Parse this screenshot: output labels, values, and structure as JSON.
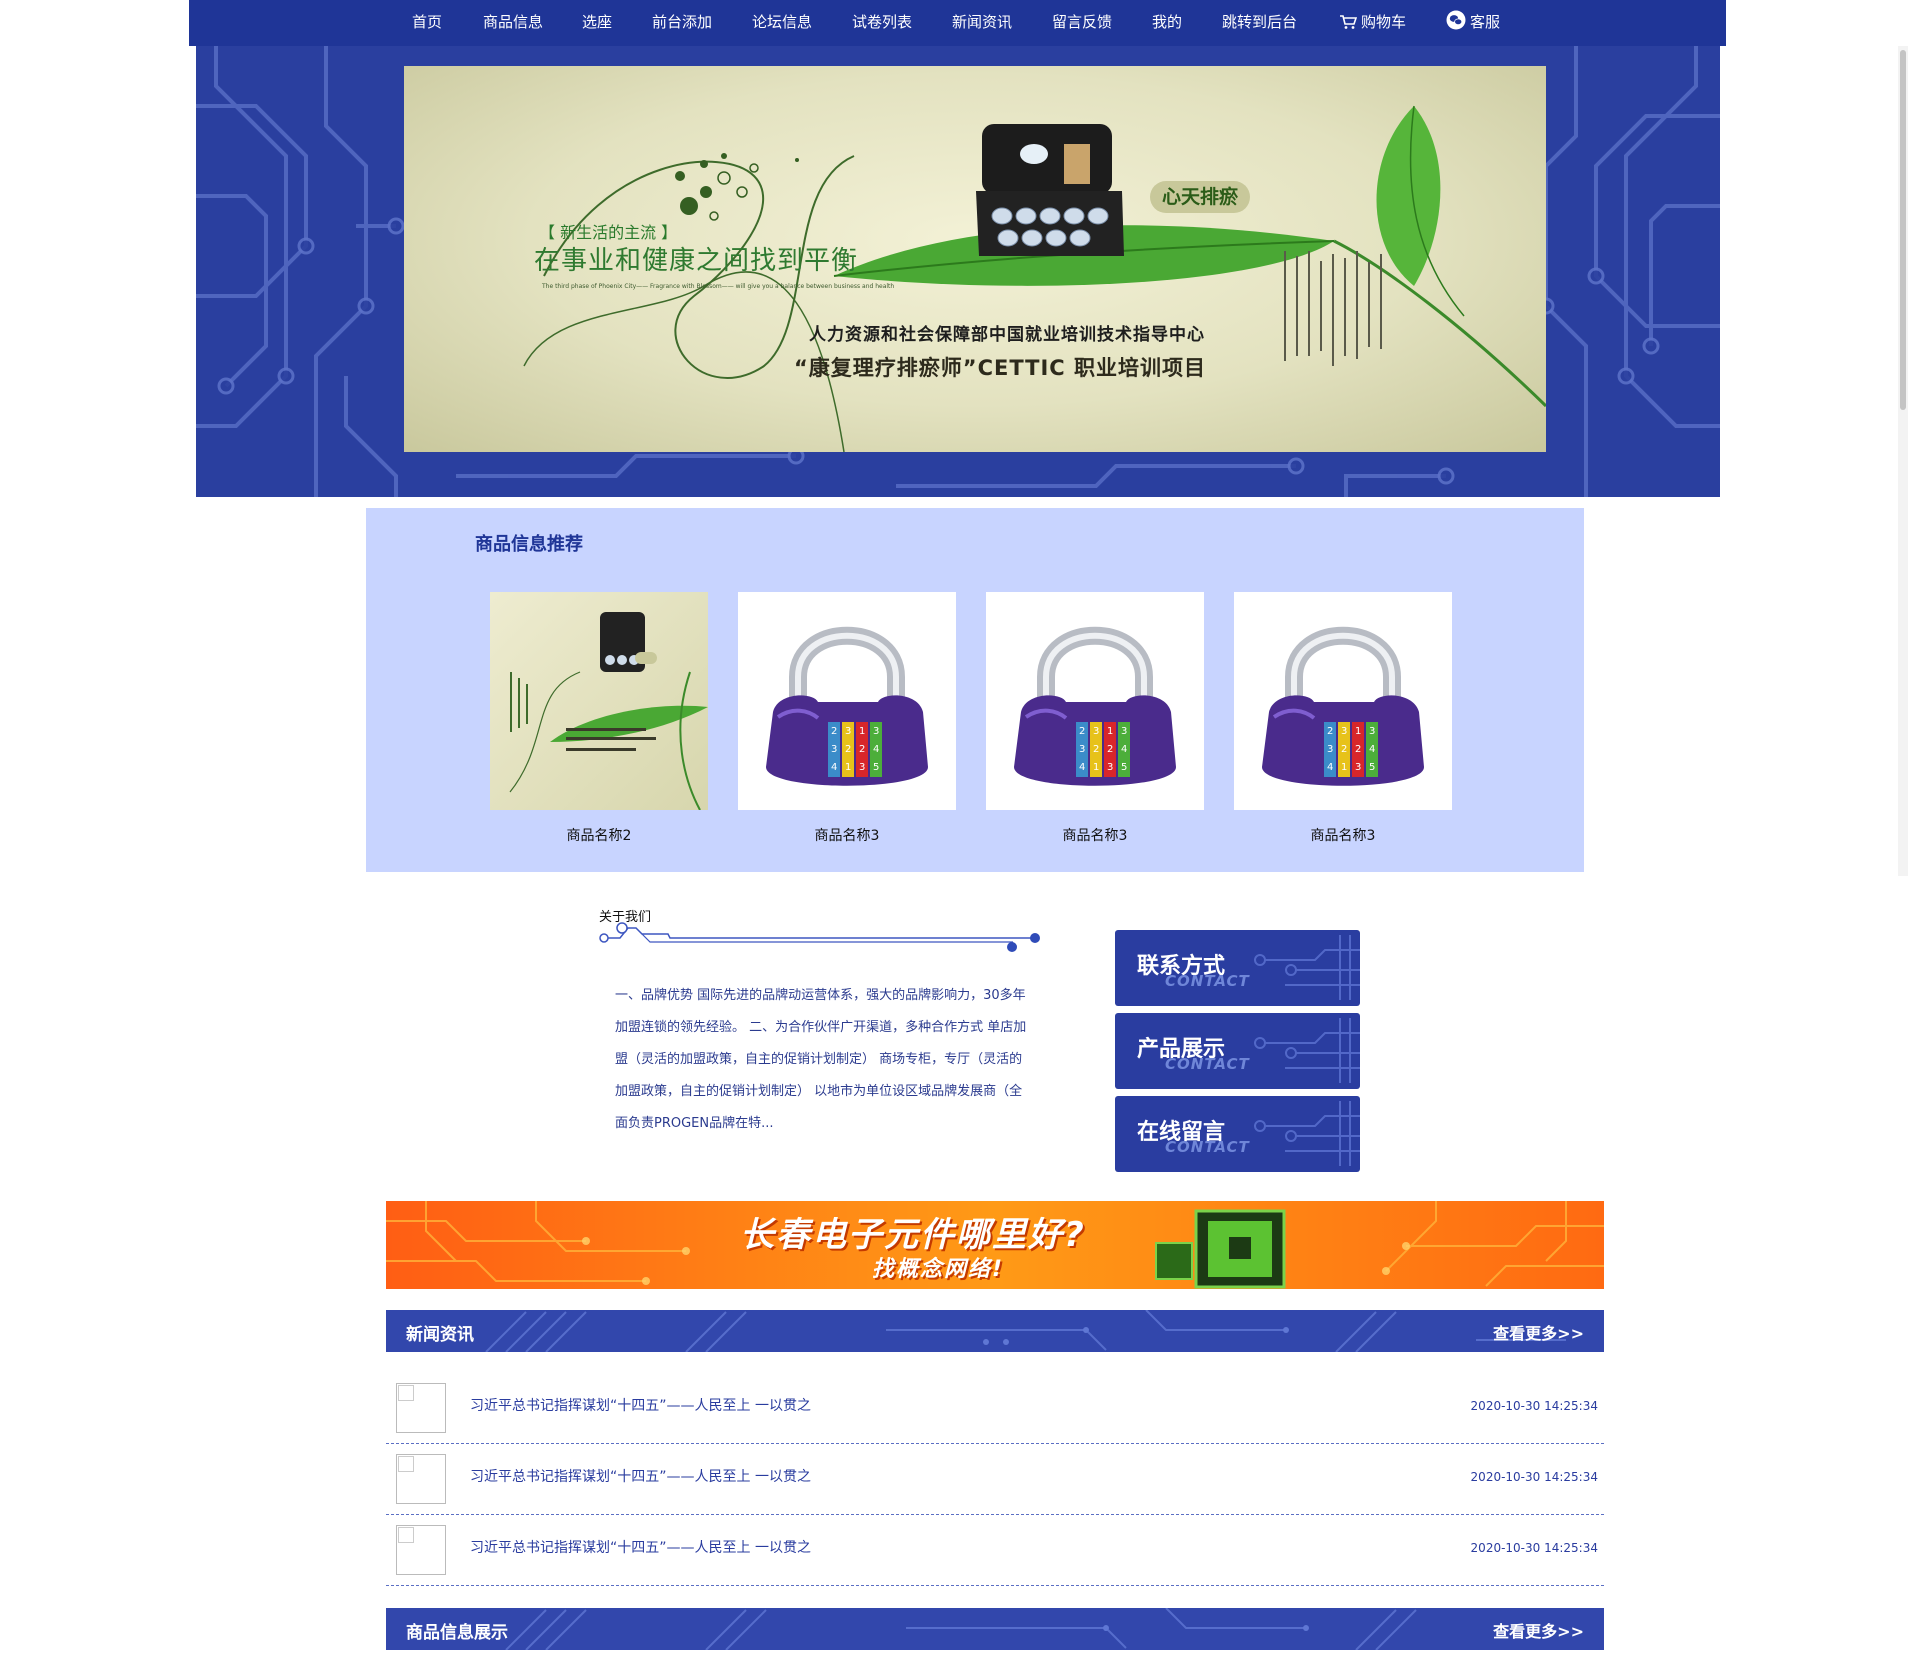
{
  "nav": {
    "items": [
      "首页",
      "商品信息",
      "选座",
      "前台添加",
      "论坛信息",
      "试卷列表",
      "新闻资讯",
      "留言反馈",
      "我的",
      "跳转到后台"
    ],
    "cart": "购物车",
    "service": "客服"
  },
  "banner": {
    "tagline": "【 新生活的主流 】",
    "slogan": "在事业和健康之间找到平衡",
    "caption": "The third phase of Phoenix City—— Fragrance with Blossom—— will give you a balance between business and health",
    "brand": "心天排瘀",
    "line1": "人力资源和社会保障部中国就业培训技术指导中心",
    "line2": "“康复理疗排瘀师”CETTIC 职业培训项目"
  },
  "recommend": {
    "title": "商品信息推荐",
    "products": [
      {
        "name": "商品名称2",
        "image": "banner-product-image"
      },
      {
        "name": "商品名称3",
        "image": "combination-lock-image"
      },
      {
        "name": "商品名称3",
        "image": "combination-lock-image"
      },
      {
        "name": "商品名称3",
        "image": "combination-lock-image"
      }
    ]
  },
  "about": {
    "title": "关于我们",
    "text": "一、品牌优势 国际先进的品牌动运营体系，强大的品牌影响力，30多年加盟连锁的领先经验。 二、为合作伙伴广开渠道，多种合作方式 单店加盟（灵活的加盟政策，自主的促销计划制定） 商场专柜，专厅（灵活的加盟政策，自主的促销计划制定） 以地市为单位设区域品牌发展商（全面负责PROGEN品牌在特..."
  },
  "side_buttons": [
    {
      "cn": "联系方式",
      "en": "CONTACT"
    },
    {
      "cn": "产品展示",
      "en": "CONTACT"
    },
    {
      "cn": "在线留言",
      "en": "CONTACT"
    }
  ],
  "ad": {
    "line1": "长春电子元件哪里好?",
    "line2": "找概念网络!"
  },
  "news": {
    "title": "新闻资讯",
    "more": "查看更多>>",
    "items": [
      {
        "title": "习近平总书记指挥谋划“十四五”——人民至上 一以贯之",
        "date": "2020-10-30 14:25:34"
      },
      {
        "title": "习近平总书记指挥谋划“十四五”——人民至上 一以贯之",
        "date": "2020-10-30 14:25:34"
      },
      {
        "title": "习近平总书记指挥谋划“十四五”——人民至上 一以贯之",
        "date": "2020-10-30 14:25:34"
      }
    ]
  },
  "products_section": {
    "title": "商品信息展示",
    "more": "查看更多>>"
  },
  "colors": {
    "nav_bg": "#1f3597",
    "recommend_bg": "#c8d4ff",
    "accent": "#2a3c9f"
  }
}
